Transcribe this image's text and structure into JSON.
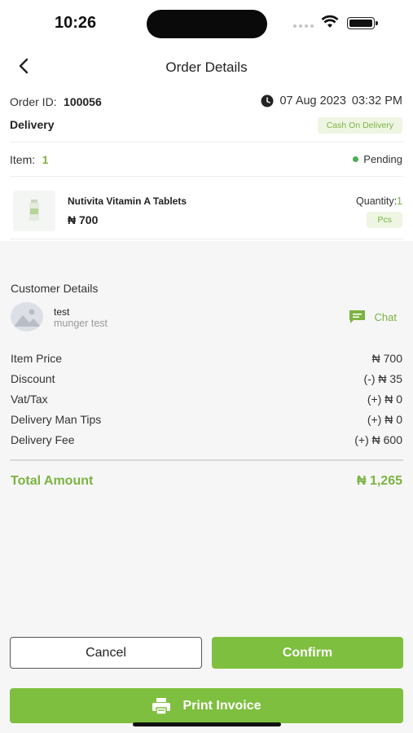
{
  "status_bar": {
    "time": "10:26"
  },
  "header": {
    "title": "Order Details"
  },
  "order": {
    "id_label": "Order ID:",
    "id_value": "100056",
    "date": "07 Aug 2023",
    "time": "03:32 PM",
    "type": "Delivery",
    "payment": "Cash On Delivery",
    "item_label": "Item:",
    "item_count": "1",
    "status": "Pending"
  },
  "product": {
    "name": "Nutivita Vitamin A Tablets",
    "price": "₦ 700",
    "quantity_label": "Quantity:",
    "quantity_value": "1",
    "unit": "Pcs"
  },
  "customer": {
    "section_title": "Customer Details",
    "name": "test",
    "address": "munger test",
    "chat_label": "Chat"
  },
  "summary": {
    "rows": [
      {
        "label": "Item Price",
        "value": "₦ 700"
      },
      {
        "label": "Discount",
        "value": "(-) ₦ 35"
      },
      {
        "label": "Vat/Tax",
        "value": "(+) ₦ 0"
      },
      {
        "label": "Delivery Man Tips",
        "value": "(+) ₦ 0"
      },
      {
        "label": "Delivery Fee",
        "value": "(+) ₦ 600"
      }
    ],
    "total_label": "Total Amount",
    "total_value": "₦ 1,265"
  },
  "actions": {
    "cancel": "Cancel",
    "confirm": "Confirm",
    "print_invoice": "Print Invoice"
  },
  "colors": {
    "accent": "#7EBF3F",
    "pill_bg": "#EEF6E3",
    "status_dot": "#4CAF50"
  }
}
